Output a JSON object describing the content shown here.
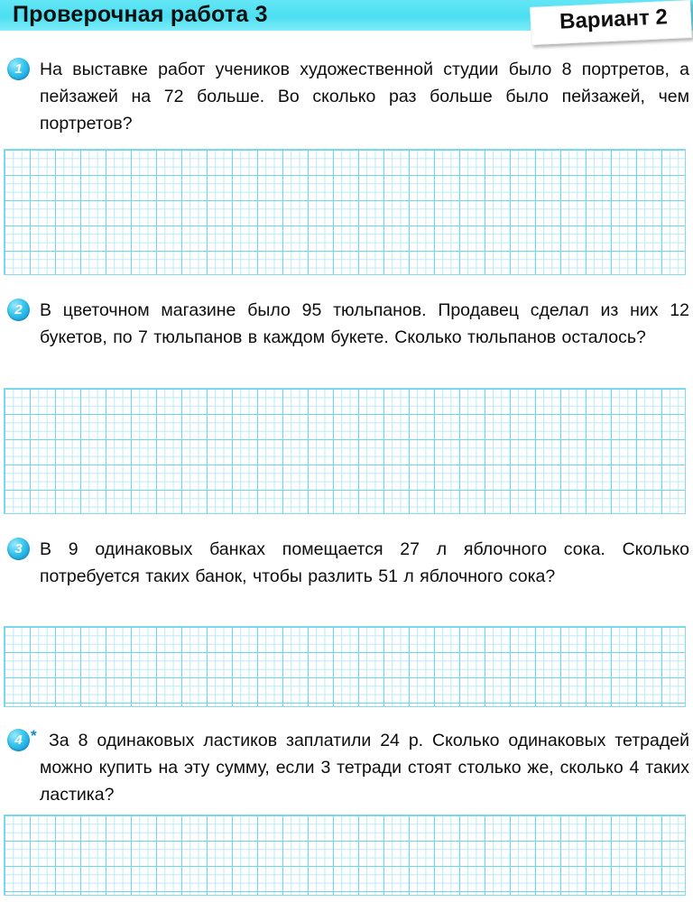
{
  "header": {
    "title": "Проверочная работа 3",
    "variant": "Вариант 2"
  },
  "tasks": [
    {
      "number": "1",
      "marker": "",
      "text": "На выставке работ учеников художественной студии было 8 портретов, а пейзажей на 72 больше. Во сколько раз больше было пейзажей, чем портретов?"
    },
    {
      "number": "2",
      "marker": "",
      "text": "В цветочном магазине было 95 тюльпанов. Продавец сделал из них 12 букетов, по 7 тюльпанов в каждом букете. Сколько тюльпанов осталось?"
    },
    {
      "number": "3",
      "marker": "",
      "text": "В 9 одинаковых банках помещается 27 л яблочного сока. Сколько потребуется таких банок, чтобы разлить 51 л яблочного сока?"
    },
    {
      "number": "4",
      "marker": "*",
      "text": "За 8 одинаковых ластиков заплатили 24 р. Сколько одинаковых тетрадей можно купить на эту сумму, если 3 тетради стоят столько же, сколько 4 таких ластика?"
    }
  ],
  "answer_areas": [
    {
      "for_task": "1",
      "rows": 5
    },
    {
      "for_task": "2",
      "rows": 5
    },
    {
      "for_task": "3",
      "rows": 3
    },
    {
      "for_task": "4",
      "rows": 3
    }
  ],
  "colors": {
    "band": "#4cdff2",
    "grid_major": "#5fd3ec",
    "grid_minor": "#b6e9f6",
    "bullet": "#1fa8e0",
    "text": "#0d0d0d"
  }
}
